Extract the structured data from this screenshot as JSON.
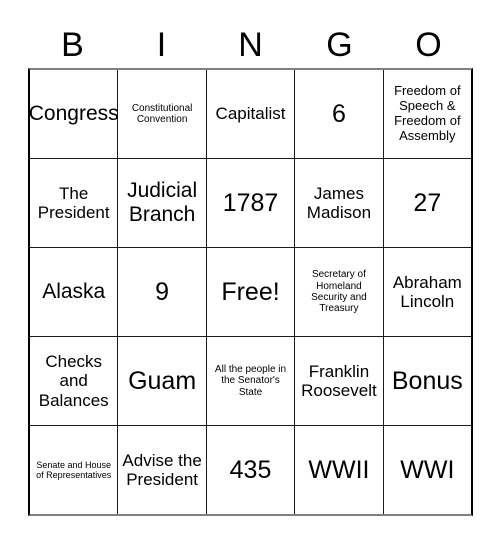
{
  "card": {
    "title": "BINGO",
    "header_letters": [
      "B",
      "I",
      "N",
      "G",
      "O"
    ],
    "free_space_label": "Free!",
    "colors": {
      "text": "#000000",
      "background": "#ffffff",
      "grid_line": "#1a1a1a",
      "outer_border_top": "#808080",
      "outer_border_side": "#000000"
    },
    "rows": [
      [
        {
          "text": "Congress",
          "size": "lg"
        },
        {
          "text": "Constitutional Convention",
          "size": "xs"
        },
        {
          "text": "Capitalist",
          "size": "md"
        },
        {
          "text": "6",
          "size": "xl"
        },
        {
          "text": "Freedom of Speech & Freedom of Assembly",
          "size": "sm"
        }
      ],
      [
        {
          "text": "The President",
          "size": "md"
        },
        {
          "text": "Judicial Branch",
          "size": "lg"
        },
        {
          "text": "1787",
          "size": "xl"
        },
        {
          "text": "James Madison",
          "size": "md"
        },
        {
          "text": "27",
          "size": "xl"
        }
      ],
      [
        {
          "text": "Alaska",
          "size": "lg"
        },
        {
          "text": "9",
          "size": "xl"
        },
        {
          "text": "Free!",
          "size": "xl"
        },
        {
          "text": "Secretary of Homeland Security and Treasury",
          "size": "xs"
        },
        {
          "text": "Abraham Lincoln",
          "size": "md"
        }
      ],
      [
        {
          "text": "Checks and Balances",
          "size": "md"
        },
        {
          "text": "Guam",
          "size": "xl"
        },
        {
          "text": "All the people in the Senator's State",
          "size": "xs"
        },
        {
          "text": "Franklin Roosevelt",
          "size": "md"
        },
        {
          "text": "Bonus",
          "size": "xl"
        }
      ],
      [
        {
          "text": "Senate and House of Representatives",
          "size": "xxs"
        },
        {
          "text": "Advise the President",
          "size": "md"
        },
        {
          "text": "435",
          "size": "xl"
        },
        {
          "text": "WWII",
          "size": "xl"
        },
        {
          "text": "WWI",
          "size": "xl"
        }
      ]
    ]
  }
}
